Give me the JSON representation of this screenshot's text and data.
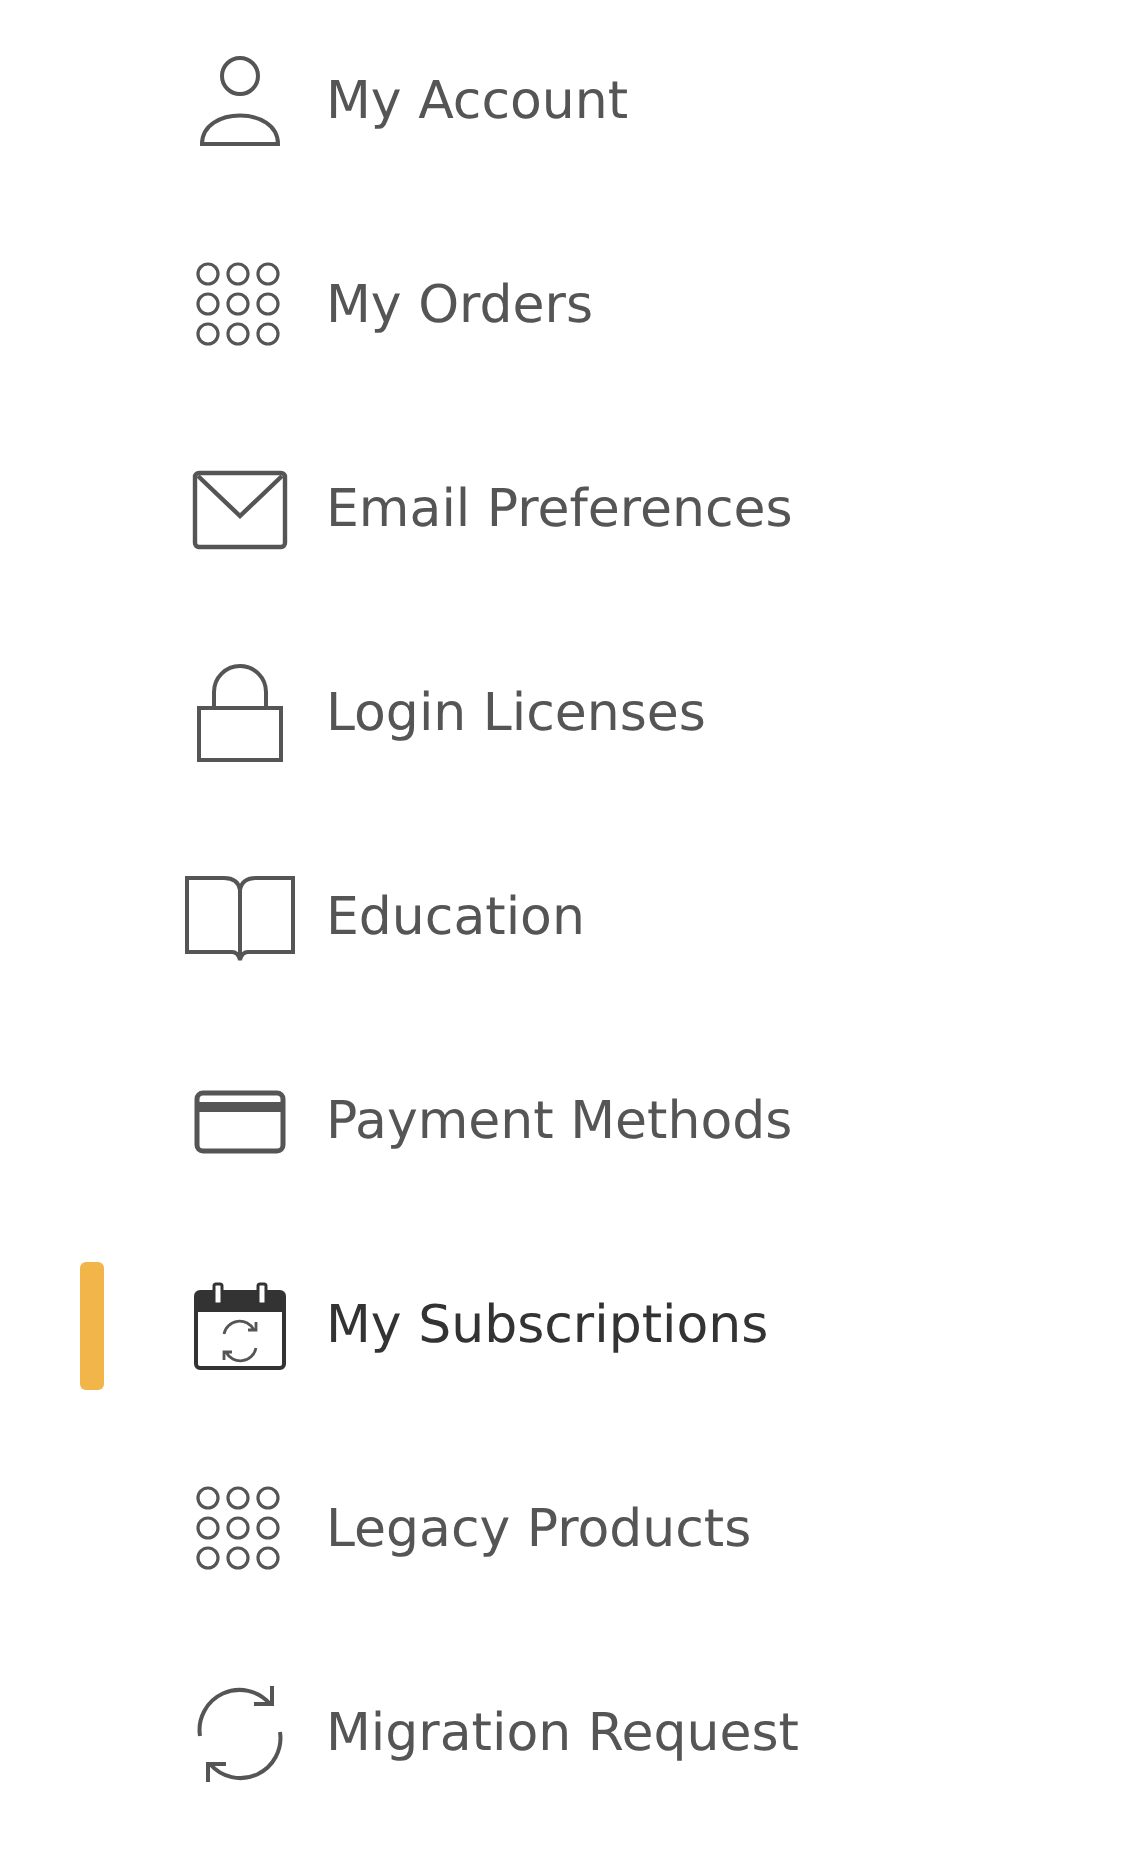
{
  "menu": {
    "items": [
      {
        "label": "My Account",
        "kind": "person",
        "selected": false
      },
      {
        "label": "My Orders",
        "kind": "grid",
        "selected": false
      },
      {
        "label": "Email Preferences",
        "kind": "mail",
        "selected": false
      },
      {
        "label": "Login Licenses",
        "kind": "lock",
        "selected": false
      },
      {
        "label": "Education",
        "kind": "book",
        "selected": false
      },
      {
        "label": "Payment Methods",
        "kind": "card",
        "selected": false
      },
      {
        "label": "My Subscriptions",
        "kind": "calendar",
        "selected": true
      },
      {
        "label": "Legacy Products",
        "kind": "grid",
        "selected": false
      },
      {
        "label": "Migration Request",
        "kind": "sync",
        "selected": false
      }
    ]
  }
}
